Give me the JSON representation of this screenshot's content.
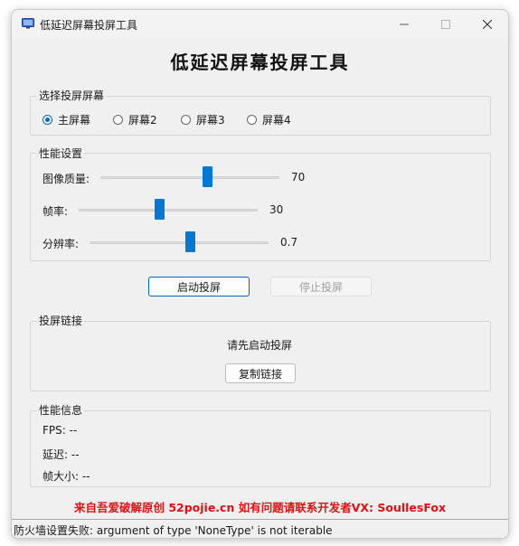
{
  "window": {
    "title": "低延迟屏幕投屏工具",
    "controls": [
      "minimize",
      "maximize",
      "close"
    ]
  },
  "heading": "低延迟屏幕投屏工具",
  "screen_select": {
    "title": "选择投屏屏幕",
    "options": [
      {
        "label": "主屏幕",
        "checked": true
      },
      {
        "label": "屏幕2",
        "checked": false
      },
      {
        "label": "屏幕3",
        "checked": false
      },
      {
        "label": "屏幕4",
        "checked": false
      }
    ]
  },
  "performance": {
    "title": "性能设置",
    "sliders": [
      {
        "label": "图像质量:",
        "value": "70",
        "position": 0.6
      },
      {
        "label": "帧率:",
        "value": "30",
        "position": 0.45
      },
      {
        "label": "分辨率:",
        "value": "0.7",
        "position": 0.56
      }
    ]
  },
  "actions": {
    "start": "启动投屏",
    "stop": "停止投屏"
  },
  "link": {
    "title": "投屏链接",
    "message": "请先启动投屏",
    "copy": "复制链接"
  },
  "info": {
    "title": "性能信息",
    "fps": "FPS: --",
    "latency": "延迟: --",
    "frame_size": "帧大小: --"
  },
  "footer": "来自吾爱破解原创 52pojie.cn 如有问题请联系开发者VX: SoullesFox",
  "status": "防火墙设置失败: argument of type 'NoneType' is not iterable",
  "colors": {
    "accent": "#0078d4",
    "footer": "#e01010",
    "background": "#f0f0f0"
  }
}
